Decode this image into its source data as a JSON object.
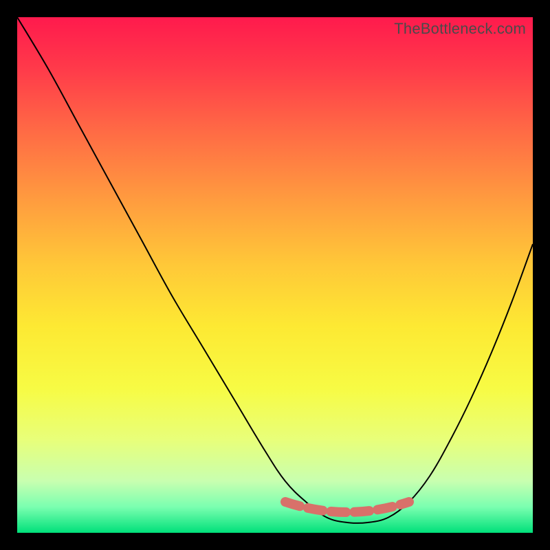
{
  "watermark": "TheBottleneck.com",
  "colors": {
    "gradient_top": "#ff1a4d",
    "gradient_bottom": "#00e07a",
    "curve": "#000000",
    "highlight": "#d8716a",
    "background": "#000000"
  },
  "chart_data": {
    "type": "line",
    "title": "",
    "xlabel": "",
    "ylabel": "",
    "xlim": [
      0,
      100
    ],
    "ylim": [
      0,
      100
    ],
    "series": [
      {
        "name": "bottleneck-curve",
        "x": [
          0,
          6,
          12,
          18,
          24,
          30,
          36,
          42,
          48,
          52,
          56,
          60,
          64,
          68,
          72,
          76,
          80,
          84,
          88,
          92,
          96,
          100
        ],
        "y": [
          100,
          90,
          79,
          68,
          57,
          46,
          36,
          26,
          16,
          10,
          6,
          3,
          2,
          2,
          3,
          6,
          11,
          18,
          26,
          35,
          45,
          56
        ]
      }
    ],
    "annotations": [
      {
        "name": "optimal-range",
        "x_range": [
          52,
          76
        ],
        "y_approx": 3,
        "style": "dashed-highlight"
      }
    ]
  }
}
